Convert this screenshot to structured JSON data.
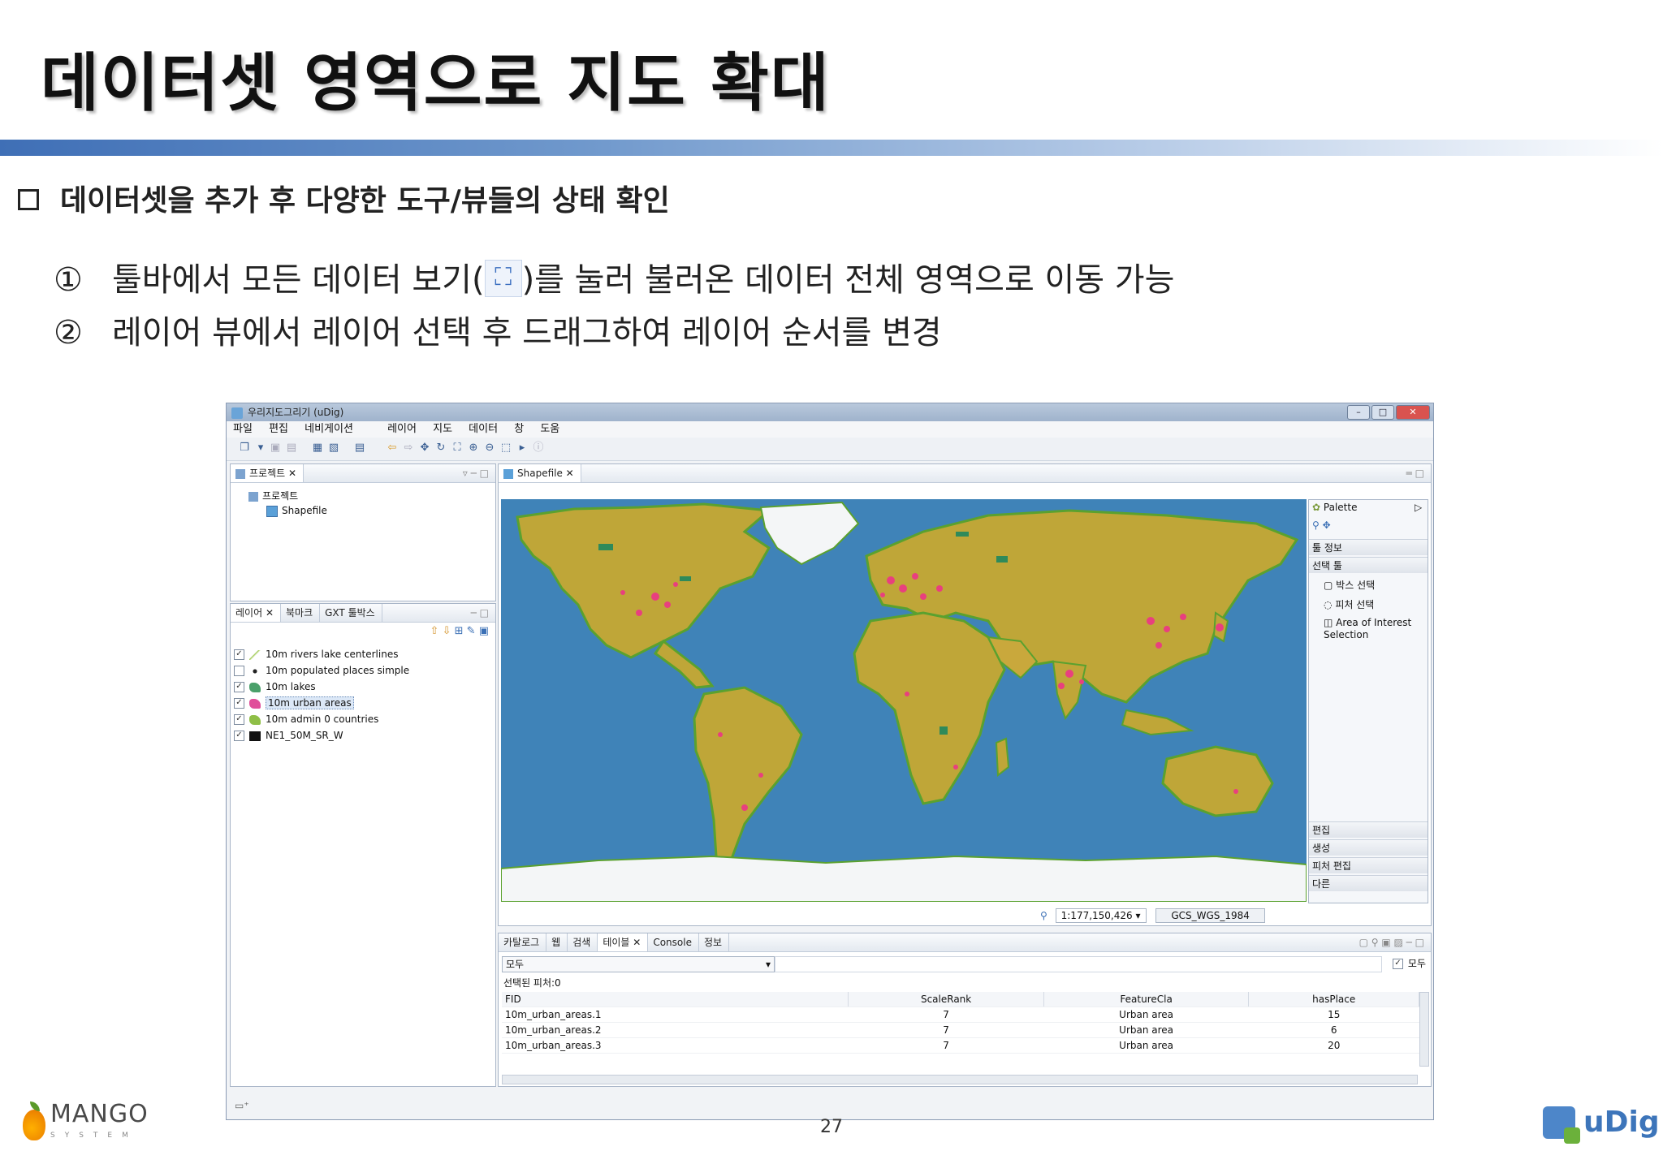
{
  "slide": {
    "title": "데이터셋 영역으로 지도 확대",
    "bullet": "데이터셋을 추가 후 다양한 도구/뷰들의 상태 확인",
    "items": [
      {
        "num": "①",
        "before": "툴바에서 모든 데이터 보기(",
        "icon": "zoom-extent-icon",
        "after": ")를 눌러 불러온 데이터 전체 영역으로 이동 가능"
      },
      {
        "num": "②",
        "text": "레이어 뷰에서 레이어 선택 후 드래그하여 레이어 순서를 변경"
      }
    ],
    "page_number": "27",
    "left_logo_text": "MANGO",
    "left_logo_sub": "SYSTEM",
    "right_logo_text": "uDig"
  },
  "app": {
    "window_title": "우리지도그리기 (uDig)",
    "menu": [
      "파일",
      "편집",
      "네비게이션",
      "레이어",
      "지도",
      "데이터",
      "창",
      "도움"
    ],
    "projects_panel": {
      "tab": "프로젝트",
      "root": "프로젝트",
      "child": "Shapefile"
    },
    "layers_panel": {
      "tabs": [
        "레이어",
        "북마크",
        "GXT 툴박스"
      ],
      "layers": [
        {
          "name": "10m rivers lake centerlines",
          "checked": true,
          "color": "#9ac64b"
        },
        {
          "name": "10m populated places simple",
          "checked": false,
          "color": "#222222"
        },
        {
          "name": "10m lakes",
          "checked": true,
          "color": "#4aa06a"
        },
        {
          "name": "10m urban areas",
          "checked": true,
          "color": "#e04f9a",
          "selected": true
        },
        {
          "name": "10m admin 0 countries",
          "checked": true,
          "color": "#8fbf47"
        },
        {
          "name": "NE1_50M_SR_W",
          "checked": true,
          "color": "#111111"
        }
      ]
    },
    "map_editor": {
      "tab": "Shapefile",
      "scale": "1:177,150,426",
      "crs": "GCS_WGS_1984"
    },
    "palette": {
      "title": "Palette",
      "sections": [
        "툴 정보",
        "선택 툴"
      ],
      "tools": [
        "박스 선택",
        "피처 선택",
        "Area of Interest Selection"
      ],
      "bottom_sections": [
        "편집",
        "생성",
        "피처 편집",
        "다른"
      ]
    },
    "bottom_panel": {
      "tabs": [
        "카탈로그",
        "웹",
        "검색",
        "테이블",
        "Console",
        "정보"
      ],
      "filter_value": "모두",
      "all_checkbox_label": "모두",
      "selected_count": "선택된 피처:0",
      "columns": [
        "FID",
        "ScaleRank",
        "FeatureCla",
        "hasPlace"
      ],
      "rows": [
        [
          "10m_urban_areas.1",
          "7",
          "Urban area",
          "15"
        ],
        [
          "10m_urban_areas.2",
          "7",
          "Urban area",
          "6"
        ],
        [
          "10m_urban_areas.3",
          "7",
          "Urban area",
          "20"
        ]
      ]
    }
  }
}
